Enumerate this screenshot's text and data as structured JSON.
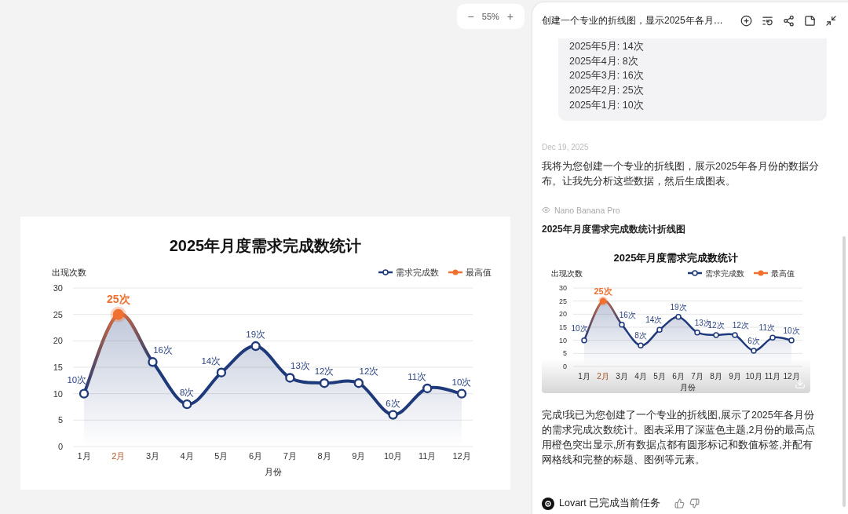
{
  "canvas": {
    "zoom": {
      "minus": "−",
      "value": "55%",
      "plus": "+"
    },
    "chart_card": {
      "chart_data": {
        "type": "area",
        "grid": true,
        "legend": true,
        "title": "2025年月度需求完成数统计",
        "xlabel": "月份",
        "ylabel": "出现次数",
        "categories": [
          "1月",
          "2月",
          "3月",
          "4月",
          "5月",
          "6月",
          "7月",
          "8月",
          "9月",
          "10月",
          "11月",
          "12月"
        ],
        "series": [
          {
            "name": "需求完成数",
            "color": "#1f3a7a",
            "marker": "circle",
            "values": [
              10,
              25,
              16,
              8,
              14,
              19,
              13,
              12,
              12,
              6,
              11,
              10
            ]
          }
        ],
        "ylim": [
          0,
          30
        ],
        "yticks": [
          0,
          5,
          10,
          15,
          20,
          25,
          30
        ],
        "value_labels": [
          "10次",
          "25次",
          "16次",
          "8次",
          "14次",
          "19次",
          "13次",
          "12次",
          "12次",
          "6次",
          "11次",
          "10次"
        ]
      },
      "peak_highlight": {
        "legend_label": "最高值",
        "color": "#f07030"
      }
    }
  },
  "panel": {
    "title": "创建一个专业的折线图，显示2025年各月…",
    "message_lines": [
      "2025年5月: 14次",
      "2025年4月: 8次",
      "2025年3月: 16次",
      "2025年2月: 25次",
      "2025年1月: 10次"
    ],
    "date": "Dec 19, 2025",
    "reply": "我将为您创建一个专业的折线图，展示2025年各月份的数据分布。让我先分析这些数据，然后生成图表。",
    "model": "Nano Banana Pro",
    "image_title": "2025年月度需求完成数统计折线图",
    "image": {
      "chart_data": {
        "type": "area",
        "grid": true,
        "legend": true,
        "title": "2025年月度需求完成数统计",
        "xlabel": "月份",
        "ylabel": "出现次数",
        "categories": [
          "1月",
          "2月",
          "3月",
          "4月",
          "5月",
          "6月",
          "7月",
          "8月",
          "9月",
          "10月",
          "11月",
          "12月"
        ],
        "series": [
          {
            "name": "需求完成数",
            "color": "#1f3a7a",
            "marker": "circle",
            "values": [
              10,
              25,
              16,
              8,
              14,
              19,
              13,
              12,
              12,
              6,
              11,
              10
            ]
          }
        ],
        "ylim": [
          0,
          30
        ],
        "yticks": [
          0,
          5,
          10,
          15,
          20,
          25,
          30
        ],
        "value_labels": [
          "10次",
          "25次",
          "16次",
          "8次",
          "14次",
          "19次",
          "13次",
          "12次",
          "12次",
          "6次",
          "11次",
          "10次"
        ]
      },
      "peak_highlight": {
        "legend_label": "最高值",
        "color": "#f07030"
      }
    },
    "summary": "完成!我已为您创建了一个专业的折线图,展示了2025年各月份的需求完成次数统计。图表采用了深蓝色主题,2月份的最高点用橙色突出显示,所有数据点都有圆形标记和数值标签,并配有网格线和完整的标题、图例等元素。",
    "footer": {
      "text": "Lovart 已完成当前任务"
    }
  }
}
